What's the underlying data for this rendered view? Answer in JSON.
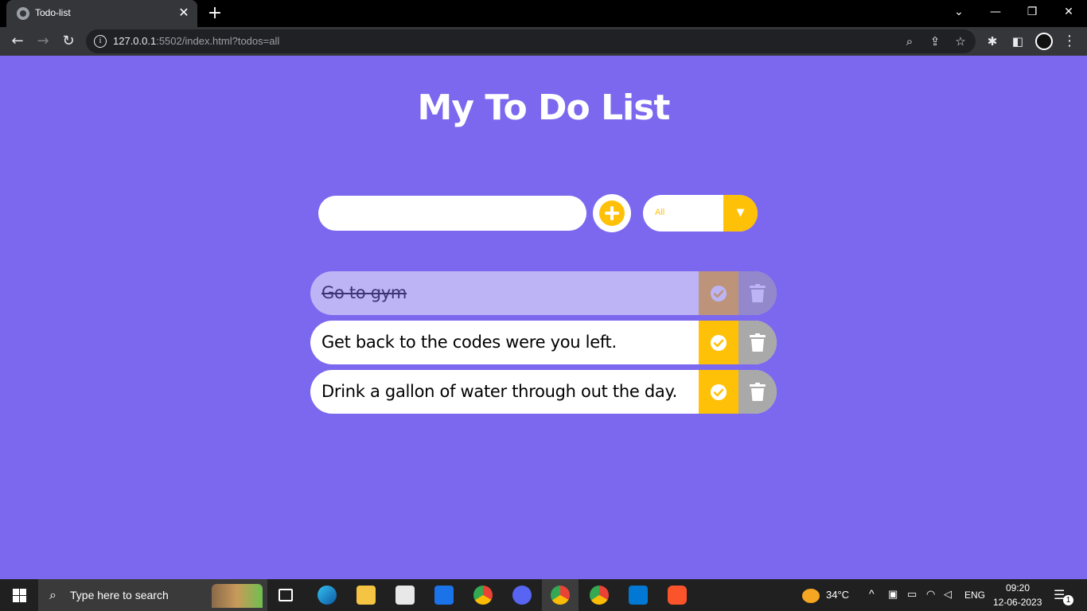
{
  "browser": {
    "tab_title": "Todo-list",
    "url_host": "127.0.0.1",
    "url_rest": ":5502/index.html?todos=all"
  },
  "page": {
    "title": "My To Do List",
    "input_value": "",
    "filter_value": "All"
  },
  "todos": [
    {
      "text": "Go to gym",
      "completed": true
    },
    {
      "text": "Get back to the codes were you left.",
      "completed": false
    },
    {
      "text": "Drink a gallon of water through out the day.",
      "completed": false
    }
  ],
  "taskbar": {
    "search_placeholder": "Type here to search",
    "weather": "34°C",
    "lang": "ENG",
    "time": "09:20",
    "date": "12-06-2023",
    "notifications": "1"
  },
  "colors": {
    "background": "#7b68ee",
    "accent": "#ffc107",
    "trash": "#a9a9a9"
  }
}
